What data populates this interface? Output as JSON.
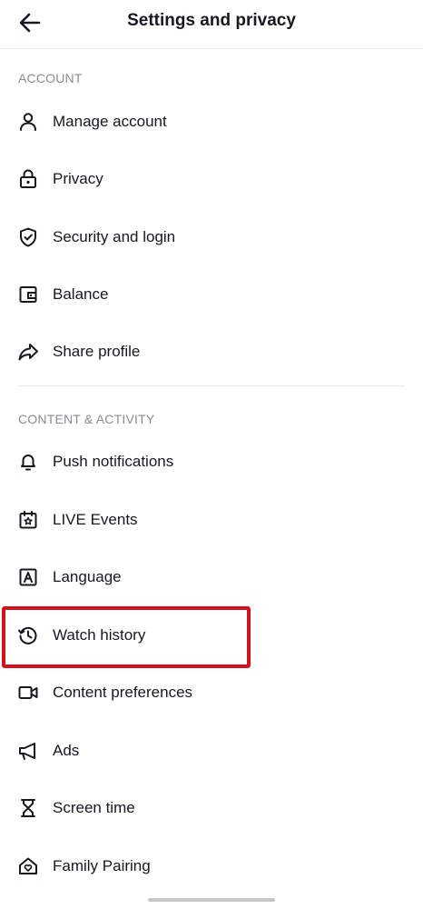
{
  "header": {
    "title": "Settings and privacy",
    "back_icon": "arrow-left-icon"
  },
  "sections": {
    "account": {
      "title": "ACCOUNT",
      "items": [
        {
          "label": "Manage account",
          "icon": "person-icon"
        },
        {
          "label": "Privacy",
          "icon": "lock-icon"
        },
        {
          "label": "Security and login",
          "icon": "shield-icon"
        },
        {
          "label": "Balance",
          "icon": "wallet-icon"
        },
        {
          "label": "Share profile",
          "icon": "share-icon"
        }
      ]
    },
    "content_activity": {
      "title": "CONTENT & ACTIVITY",
      "items": [
        {
          "label": "Push notifications",
          "icon": "bell-icon"
        },
        {
          "label": "LIVE Events",
          "icon": "calendar-star-icon"
        },
        {
          "label": "Language",
          "icon": "language-icon"
        },
        {
          "label": "Watch history",
          "icon": "history-icon"
        },
        {
          "label": "Content preferences",
          "icon": "video-camera-icon"
        },
        {
          "label": "Ads",
          "icon": "megaphone-icon"
        },
        {
          "label": "Screen time",
          "icon": "hourglass-icon"
        },
        {
          "label": "Family Pairing",
          "icon": "house-heart-icon"
        }
      ]
    }
  },
  "highlight_color": "#d3121c"
}
